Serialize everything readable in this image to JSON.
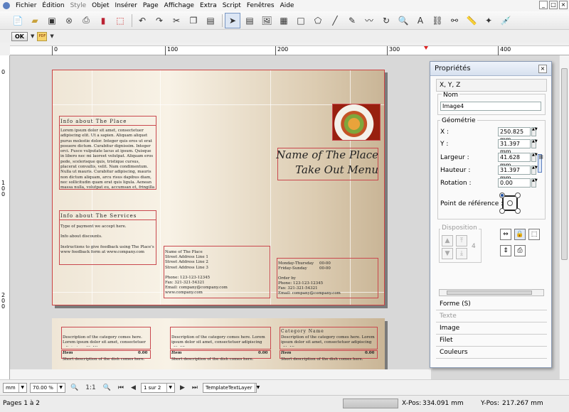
{
  "menubar": {
    "items": [
      "Fichier",
      "Édition",
      "Style",
      "Objet",
      "Insérer",
      "Page",
      "Affichage",
      "Extra",
      "Script",
      "Fenêtres",
      "Aide"
    ],
    "window_buttons": [
      "_",
      "□",
      "×"
    ]
  },
  "toolbar": {
    "icons": [
      "new-document",
      "open-folder",
      "save",
      "close",
      "print",
      "preflight",
      "pdf-export",
      "undo",
      "redo",
      "cut",
      "copy",
      "paste",
      "select",
      "text-frame",
      "image-frame",
      "table",
      "shape",
      "polygon",
      "line",
      "bezier",
      "freehand",
      "rotate",
      "zoom",
      "edit-contents",
      "link-frames",
      "unlink-frames",
      "measurements",
      "copy-properties",
      "eyedropper"
    ]
  },
  "toolbar2": {
    "ok_label": "OK",
    "pdf_label": "PDF"
  },
  "ruler": {
    "h_ticks": [
      "0",
      "100",
      "200",
      "300",
      "400"
    ],
    "v_ticks": [
      "0",
      "100",
      "200"
    ]
  },
  "document": {
    "info_about_place": {
      "title": "Info about The Place",
      "body": "Lorem ipsum dolor sit amet, consectetuer adipiscing elit. Ut a sapien. Aliquam aliquet purus molestie dolor. Integer quis eros ut erat posuere dictum. Curabitur dignissim. Integer orci. Fusce vulputate lacus at ipsum. Quisque in libero nec mi laoreet volutpat. Aliquam eros pede, scelerisque quis, tristique cursus, placerat convallis, velit. Nam condimentum. Nulla ut mauris. Curabitur adipiscing, mauris non dictum aliquam, arcu risus dapibus diam, nec sollicitudin quam erat quis ligula. Aenean massa nulla, volutpat eu, accumsan et, fringilla eget, odio. Nulla placerat porta justo. Nulla vitae turpis."
    },
    "info_about_services": {
      "title": "Info about The Services",
      "lines": [
        "Type of payment we accept here.",
        "Info about discounts.",
        "Instructions to give feedback using The Place's www feedback form at www.company.com"
      ]
    },
    "title_line1": "Name of The Place",
    "title_line2": "Take Out Menu",
    "address": {
      "lines": [
        "Name of The Place",
        "Street Address Line 1",
        "Street Address Line 2",
        "Street Address Line 3",
        "",
        "Phone: 123-123-12345",
        "Fax: 321-321-54321",
        "Email: company@company.com",
        "www.company.com"
      ]
    },
    "hours": {
      "rows": [
        [
          "Monday-Thursday",
          "00-00"
        ],
        [
          "Friday-Sunday",
          "00-00"
        ]
      ],
      "lines": [
        "Order by",
        "Phone: 123-123-12345",
        "Fax: 321-321-54321",
        "Email: company@company.com"
      ]
    },
    "page2": {
      "desc": "Description of the category comes here. Lorem ipsum dolor sit amet, consectetuer adipiscing elit. Ut a",
      "category_title": "Category Name",
      "item_label": "Item",
      "item_price": "0.00",
      "item_desc": "Short description of the dish comes here."
    }
  },
  "properties": {
    "title": "Propriétés",
    "tab": "X, Y, Z",
    "name_label": "Nom",
    "name_value": "Image4",
    "geometry_label": "Géométrie",
    "fields": [
      {
        "label": "X :",
        "value": "250.825 mm"
      },
      {
        "label": "Y :",
        "value": "31.397 mm"
      },
      {
        "label": "Largeur :",
        "value": "41.628 mm"
      },
      {
        "label": "Hauteur :",
        "value": "31.397 mm"
      },
      {
        "label": "Rotation :",
        "value": "0.00"
      }
    ],
    "ref_point_label": "Point de référence :",
    "disposition_label": "Disposition",
    "level_value": "4",
    "sections": [
      "Forme (S)",
      "Texte",
      "Image",
      "Filet",
      "Couleurs"
    ]
  },
  "navbar": {
    "unit": "mm",
    "zoom": "70.00 %",
    "zoom_ratio": "1:1",
    "page_display": "1 sur 2",
    "layer": "TemplateTextLayer"
  },
  "status": {
    "pages": "Pages 1 à 2",
    "xpos_label": "X-Pos:",
    "xpos_value": "334.091 mm",
    "ypos_label": "Y-Pos:",
    "ypos_value": "217.267 mm"
  }
}
